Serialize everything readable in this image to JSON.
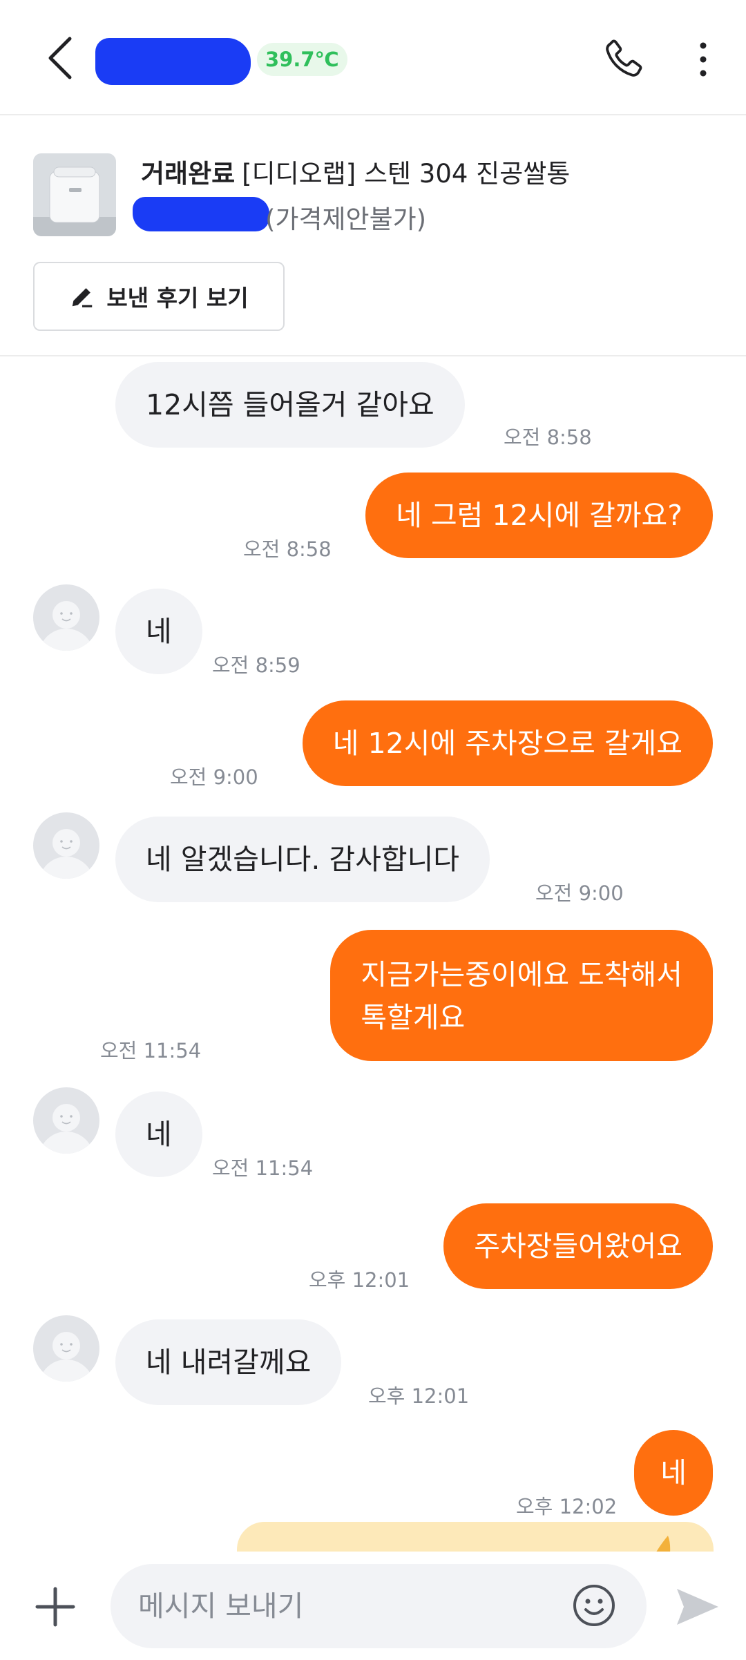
{
  "header": {
    "temperature": "39.7℃",
    "icons": {
      "back": "back-arrow-icon",
      "call": "phone-icon",
      "more": "more-vertical-icon"
    }
  },
  "product": {
    "status": "거래완료",
    "title": "[디디오랩] 스텐 304 진공쌀통",
    "price_note": "(가격제안불가)",
    "review_button": "보낸 후기 보기"
  },
  "messages": [
    {
      "side": "in",
      "text": "12시쯤 들어올거 같아요",
      "time": "오전 8:58"
    },
    {
      "side": "out",
      "text": "네 그럼 12시에 갈까요?",
      "time": "오전 8:58"
    },
    {
      "side": "in",
      "text": "네",
      "time": "오전 8:59"
    },
    {
      "side": "out",
      "text": "네 12시에 주차장으로 갈게요",
      "time": "오전 9:00"
    },
    {
      "side": "in",
      "text": "네 알겠습니다. 감사합니다",
      "time": "오전 9:00"
    },
    {
      "side": "out",
      "text_line1": "지금가는중이에요 도착해서",
      "text_line2": "톡할게요",
      "time": "오전 11:54"
    },
    {
      "side": "in",
      "text": "네",
      "time": "오전 11:54"
    },
    {
      "side": "out",
      "text": "주차장들어왔어요",
      "time": "오후 12:01"
    },
    {
      "side": "in",
      "text": "네 내려갈께요",
      "time": "오후 12:01"
    },
    {
      "side": "out",
      "text": "네",
      "time": "오후 12:02"
    }
  ],
  "input": {
    "placeholder": "메시지 보내기"
  },
  "colors": {
    "outgoing": "#ff6f0f",
    "incoming": "#f2f3f6",
    "temperature": "#2fbf5b"
  }
}
